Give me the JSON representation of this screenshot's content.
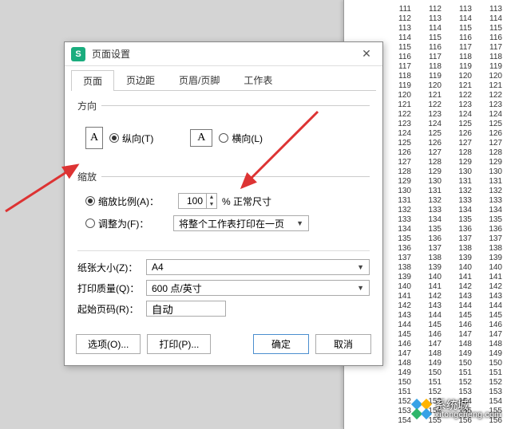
{
  "dialog": {
    "title": "页面设置",
    "tabs": [
      "页面",
      "页边距",
      "页眉/页脚",
      "工作表"
    ],
    "active_tab": 0
  },
  "orientation": {
    "group_label": "方向",
    "portrait_label": "纵向(T)",
    "landscape_label": "横向(L)",
    "icon_letter": "A",
    "selected": "portrait"
  },
  "scale": {
    "group_label": "缩放",
    "ratio": {
      "label": "缩放比例(A)：",
      "value": "100",
      "suffix": "% 正常尺寸",
      "selected": true
    },
    "fit": {
      "label": "调整为(F)：",
      "value": "将整个工作表打印在一页",
      "selected": false
    }
  },
  "paper_size": {
    "label": "纸张大小(Z)：",
    "value": "A4"
  },
  "print_quality": {
    "label": "打印质量(Q)：",
    "value": "600 点/英寸"
  },
  "start_page": {
    "label": "起始页码(R)：",
    "value": "自动"
  },
  "buttons": {
    "options": "选项(O)...",
    "print": "打印(P)...",
    "ok": "确定",
    "cancel": "取消"
  },
  "watermark": {
    "text": "系统城",
    "url": "xitongcheng.com"
  },
  "bg_start": 111
}
